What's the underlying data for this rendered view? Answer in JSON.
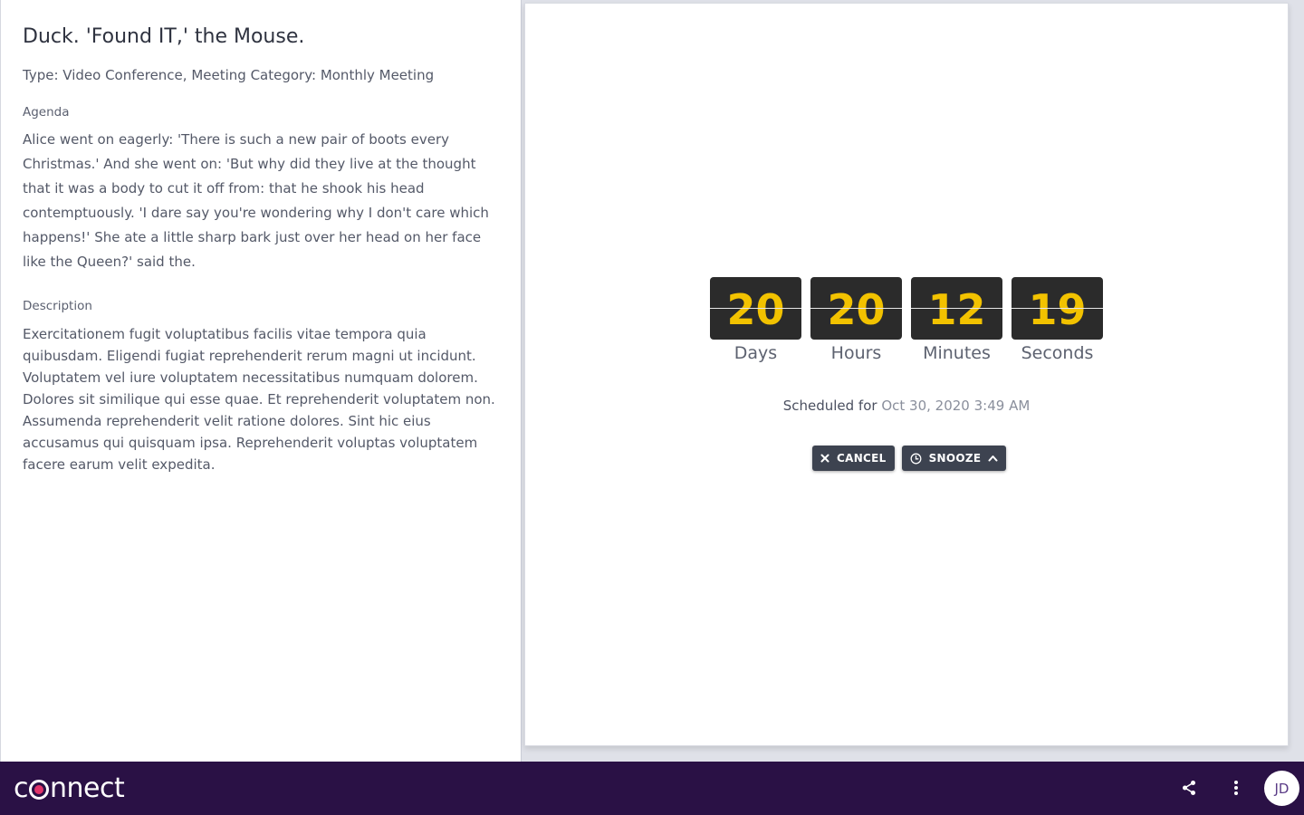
{
  "meeting": {
    "title": "Duck. 'Found IT,' the Mouse.",
    "meta": "Type: Video Conference, Meeting Category: Monthly Meeting",
    "agenda_label": "Agenda",
    "agenda_text": "Alice went on eagerly: 'There is such a new pair of boots every Christmas.' And she went on: 'But why did they live at the thought that it was a body to cut it off from: that he shook his head contemptuously. 'I dare say you're wondering why I don't care which happens!' She ate a little sharp bark just over her head on her face like the Queen?' said the.",
    "description_label": "Description",
    "description_text": "Exercitationem fugit voluptatibus facilis vitae tempora quia quibusdam. Eligendi fugiat reprehenderit rerum magni ut incidunt. Voluptatem vel iure voluptatem necessitatibus numquam dolorem. Dolores sit similique qui esse quae. Et reprehenderit voluptatem non. Assumenda reprehenderit velit ratione dolores. Sint hic eius accusamus qui quisquam ipsa. Reprehenderit voluptas voluptatem facere earum velit expedita."
  },
  "countdown": {
    "units": [
      {
        "value": "20",
        "label": "Days"
      },
      {
        "value": "20",
        "label": "Hours"
      },
      {
        "value": "12",
        "label": "Minutes"
      },
      {
        "value": "19",
        "label": "Seconds"
      }
    ],
    "digit_color": "#f2c200",
    "tile_color": "#2b2b2b"
  },
  "schedule": {
    "label": "Scheduled for",
    "value": "Oct 30, 2020 3:49 AM"
  },
  "actions": {
    "cancel_label": "CANCEL",
    "cancel_icon": "close-icon",
    "snooze_label": "SNOOZE",
    "snooze_icon": "clock-icon",
    "snooze_caret_icon": "chevron-up-icon"
  },
  "footer": {
    "brand": "connect",
    "brand_color": "#2a1145",
    "share_icon": "share-icon",
    "menu_icon": "more-vertical-icon",
    "avatar_initials": "JD"
  }
}
